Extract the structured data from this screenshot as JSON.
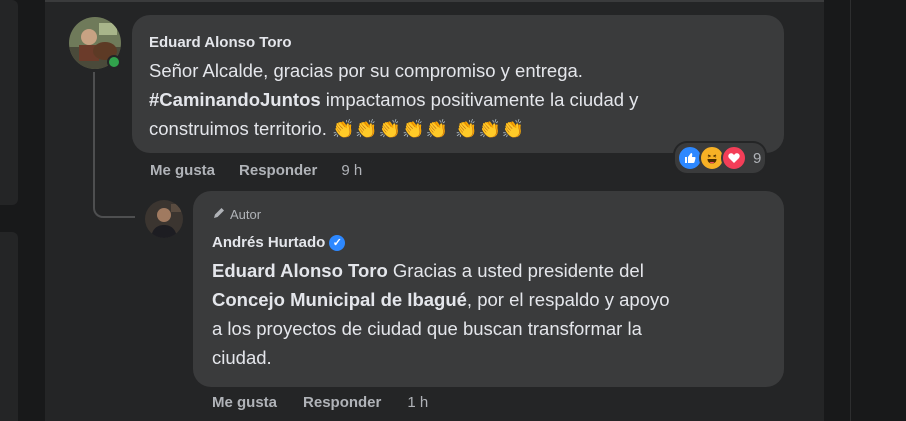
{
  "comment": {
    "author": "Eduard Alonso Toro",
    "line1": "Señor Alcalde, gracias por su compromiso y entrega.",
    "hashtag": "#CaminandoJuntos",
    "line2_rest": " impactamos positivamente la ciudad y",
    "line3": "construimos territorio.",
    "emojis": "👏👏👏👏👏 👏👏👏",
    "reaction_count": "9",
    "like_label": "Me gusta",
    "reply_label": "Responder",
    "time": "9 h"
  },
  "reply": {
    "badge": "Autor",
    "author": "Andrés Hurtado",
    "mention": "Eduard Alonso Toro",
    "line1_rest": " Gracias a usted presidente del",
    "bold2": "Concejo Municipal de Ibagué",
    "line2_rest": ", por el respaldo y apoyo",
    "line3": "a los proyectos de ciudad que buscan transformar la",
    "line4": "ciudad.",
    "like_label": "Me gusta",
    "reply_label": "Responder",
    "time": "1 h"
  },
  "colors": {
    "background": "#18191a",
    "surface": "#242526",
    "bubble": "#3a3b3c",
    "text": "#e4e6eb",
    "muted": "#b0b3b8",
    "online": "#31a24c",
    "verified": "#2d88ff"
  },
  "icons": [
    "like-reaction-icon",
    "haha-reaction-icon",
    "love-reaction-icon",
    "pencil-icon",
    "verified-icon",
    "online-status-icon"
  ]
}
